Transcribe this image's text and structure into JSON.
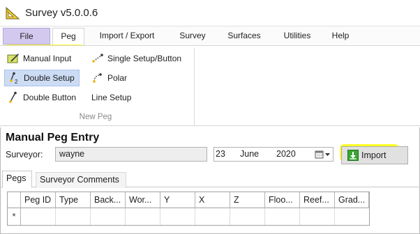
{
  "window": {
    "title": "Survey v5.0.0.6"
  },
  "menu": {
    "file_label": "File",
    "tabs": [
      {
        "label": "Peg",
        "active": true
      },
      {
        "label": "Import / Export",
        "active": false
      },
      {
        "label": "Survey",
        "active": false
      },
      {
        "label": "Surfaces",
        "active": false
      },
      {
        "label": "Utilities",
        "active": false
      },
      {
        "label": "Help",
        "active": false
      }
    ]
  },
  "ribbon": {
    "group_label": "New Peg",
    "buttons": [
      {
        "label": "Manual Input",
        "icon": "manual-input-icon",
        "selected": false
      },
      {
        "label": "Double Setup",
        "icon": "double-setup-icon",
        "selected": true
      },
      {
        "label": "Double Button",
        "icon": "double-button-icon",
        "selected": false
      },
      {
        "label": "Single Setup/Button",
        "icon": "single-setup-icon",
        "selected": false
      },
      {
        "label": "Polar",
        "icon": "polar-icon",
        "selected": false
      },
      {
        "label": "Line Setup",
        "icon": "line-setup-icon",
        "selected": false
      }
    ]
  },
  "entry": {
    "title": "Manual Peg Entry",
    "surveyor_label": "Surveyor:",
    "surveyor_value": "wayne",
    "date": {
      "day": "23",
      "month": "June",
      "year": "2020"
    },
    "import_label": "Import"
  },
  "tabs": [
    {
      "label": "Pegs",
      "active": true
    },
    {
      "label": "Surveyor Comments",
      "active": false
    }
  ],
  "grid": {
    "columns": [
      "Peg ID",
      "Type",
      "Back...",
      "Wor...",
      "Y",
      "X",
      "Z",
      "Floo...",
      "Reef...",
      "Grad..."
    ],
    "new_row_marker": "*"
  },
  "colors": {
    "highlight": "#ffff00",
    "file_tab": "#d3c9ef",
    "selected_button": "#ccdcf4",
    "import_icon": "#3aa535"
  }
}
